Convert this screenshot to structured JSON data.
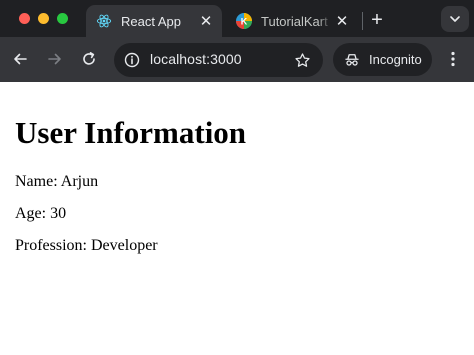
{
  "browser": {
    "tabs": [
      {
        "title": "React App",
        "favicon": "react-icon",
        "active": true
      },
      {
        "title": "TutorialKart -",
        "favicon": "tutorialkart-icon",
        "active": false
      }
    ],
    "new_tab_label": "+",
    "close_label": "✕",
    "url": "localhost:3000",
    "incognito_label": "Incognito",
    "colors": {
      "tabbar": "#1f2023",
      "toolbar": "#35363a",
      "omnibox": "#202124",
      "react_accent": "#61dafb"
    }
  },
  "page": {
    "heading": "User Information",
    "name_line": "Name: Arjun",
    "age_line": "Age: 30",
    "profession_line": "Profession: Developer"
  }
}
